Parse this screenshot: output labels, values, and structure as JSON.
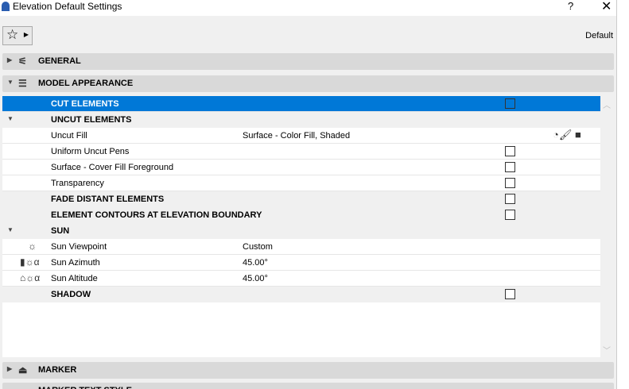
{
  "window": {
    "title": "Elevation Default Settings",
    "help": "?",
    "close": "✕"
  },
  "toolbar": {
    "favorites_icon": "star-icon",
    "default_label": "Default"
  },
  "panels": {
    "general": "GENERAL",
    "model_appearance": "MODEL APPEARANCE",
    "marker": "MARKER",
    "marker_text_style": "MARKER TEXT STYLE"
  },
  "rows": [
    {
      "label": "CUT ELEMENTS",
      "checked": false
    },
    {
      "label": "UNCUT ELEMENTS"
    },
    {
      "label": "Uncut Fill",
      "value": "Surface - Color Fill, Shaded"
    },
    {
      "label": "Uniform Uncut Pens",
      "checked": false
    },
    {
      "label": "Surface - Cover Fill Foreground",
      "checked": false
    },
    {
      "label": "Transparency",
      "checked": false
    },
    {
      "label": "FADE DISTANT ELEMENTS",
      "checked": false
    },
    {
      "label": "ELEMENT CONTOURS AT ELEVATION BOUNDARY",
      "checked": false
    },
    {
      "label": "SUN"
    },
    {
      "label": "Sun Viewpoint",
      "value": "Custom"
    },
    {
      "label": "Sun Azimuth",
      "value": "45.00°"
    },
    {
      "label": "Sun Altitude",
      "value": "45.00°"
    },
    {
      "label": "SHADOW",
      "checked": false
    }
  ],
  "colors": {
    "selection": "#0078d7",
    "panel": "#d9d9d9"
  }
}
